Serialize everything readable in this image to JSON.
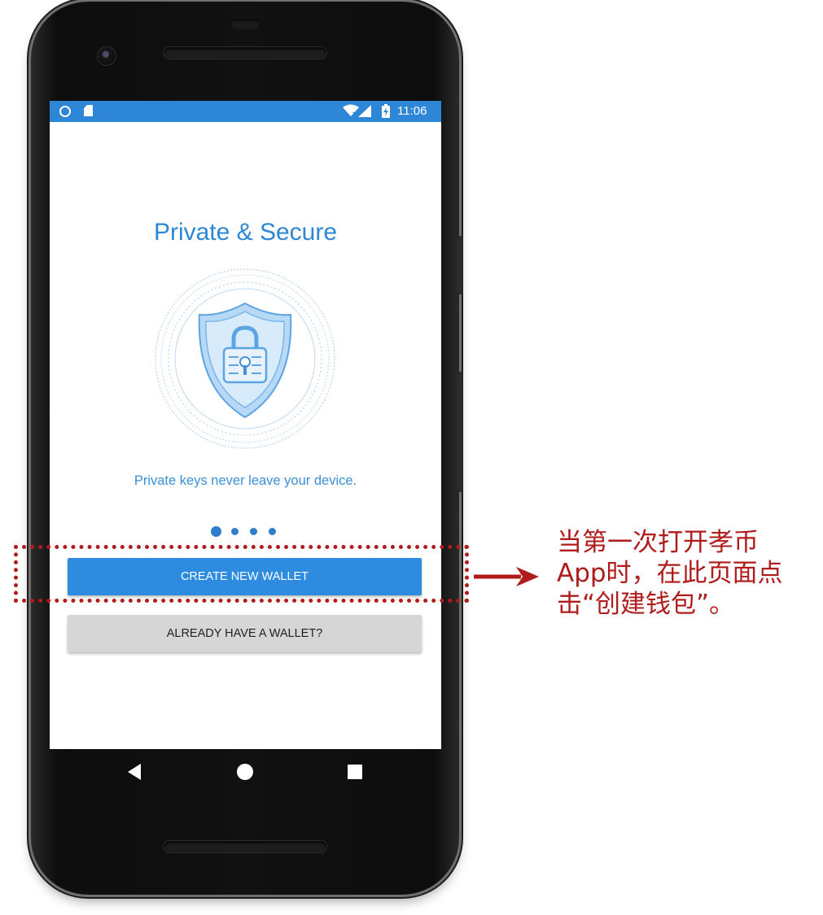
{
  "status_bar": {
    "time": "11:06",
    "icons": [
      "notification-circle-icon",
      "sd-card-icon",
      "wifi-icon",
      "signal-icon",
      "battery-charging-icon"
    ]
  },
  "onboarding": {
    "title": "Private & Secure",
    "illustration": "shield-lock-icon",
    "subtitle": "Private keys never leave your device.",
    "page_indicator": {
      "total": 4,
      "active": 1
    }
  },
  "actions": {
    "create_wallet_label": "CREATE NEW WALLET",
    "existing_wallet_label": "ALREADY HAVE A WALLET?"
  },
  "nav_bar": {
    "icons": [
      "back-icon",
      "home-icon",
      "recents-icon"
    ]
  },
  "annotation": {
    "text": "当第一次打开孝币\nApp时，在此页面点\n击“创建钱包”。",
    "color": "#b01b1b"
  },
  "colors": {
    "accent": "#2d87d5",
    "status_bar": "#2e86d6",
    "primary_button": "#2d8ce0",
    "secondary_button": "#d6d6d6",
    "annotation": "#b01b1b"
  }
}
